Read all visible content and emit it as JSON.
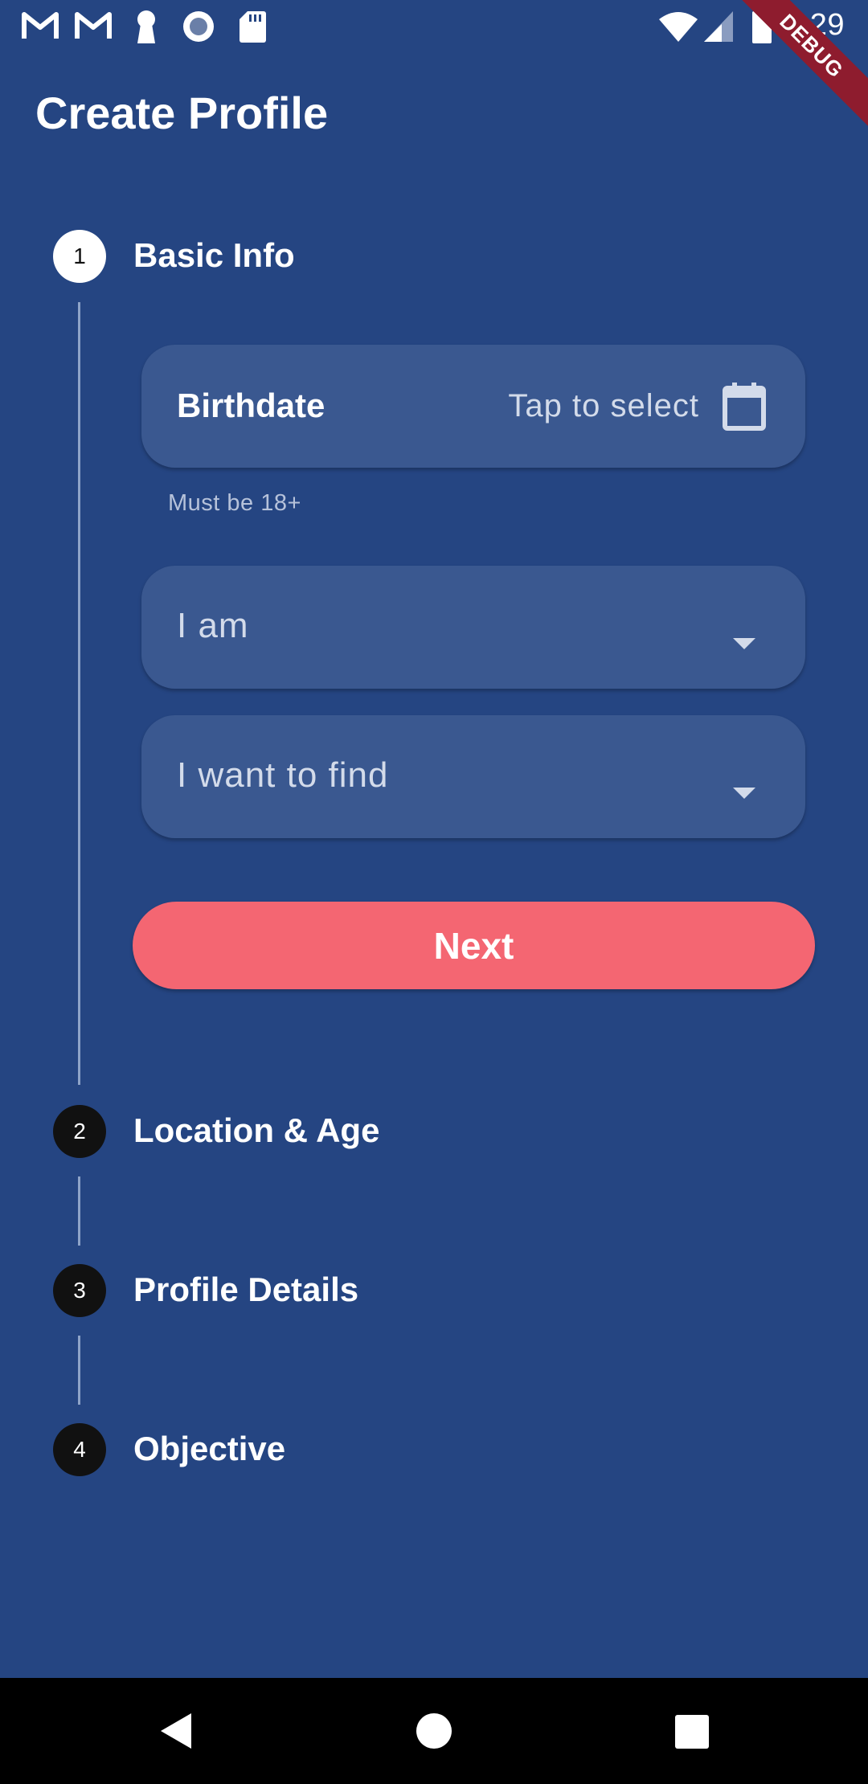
{
  "status_bar": {
    "time": "1:29",
    "icons": [
      "gmail-icon",
      "gmail-icon",
      "keyhole-icon",
      "record-icon",
      "sd-card-icon",
      "wifi-icon",
      "signal-icon",
      "battery-icon"
    ],
    "debug_label": "DEBUG"
  },
  "app_bar": {
    "title": "Create Profile"
  },
  "stepper": {
    "steps": [
      {
        "number": "1",
        "title": "Basic Info",
        "state": "active"
      },
      {
        "number": "2",
        "title": "Location & Age",
        "state": "inactive"
      },
      {
        "number": "3",
        "title": "Profile Details",
        "state": "inactive"
      },
      {
        "number": "4",
        "title": "Objective",
        "state": "inactive"
      }
    ]
  },
  "form": {
    "birthdate": {
      "label": "Birthdate",
      "value": "Tap to select",
      "icon": "calendar-icon",
      "helper": "Must be 18+"
    },
    "gender": {
      "label": "I am"
    },
    "seeking": {
      "label": "I want to find"
    },
    "next_label": "Next"
  },
  "colors": {
    "background": "#254582",
    "card": "#3a5890",
    "accent": "#f46672",
    "debug_ribbon": "#8e1c2e"
  }
}
